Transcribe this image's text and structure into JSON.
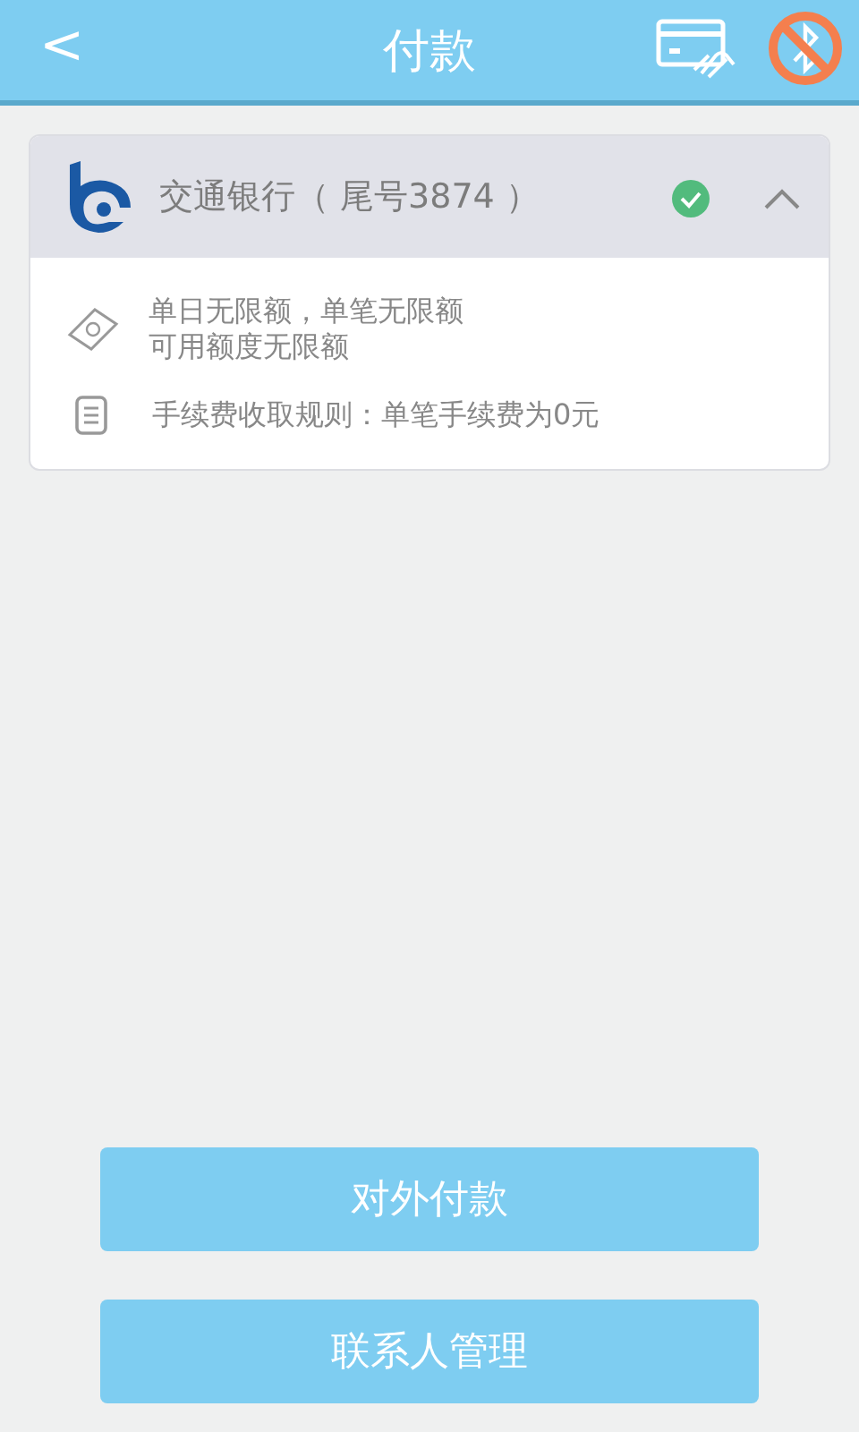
{
  "header": {
    "back": "<",
    "title": "付款"
  },
  "account": {
    "bank": "交通银行（ 尾号3874 ）",
    "selected": true,
    "expanded": true,
    "limits": [
      "单日无限额，单笔无限额",
      "可用额度无限额"
    ],
    "fee": "手续费收取规则：单笔手续费为0元"
  },
  "buttons": [
    "对外付款",
    "联系人管理"
  ]
}
